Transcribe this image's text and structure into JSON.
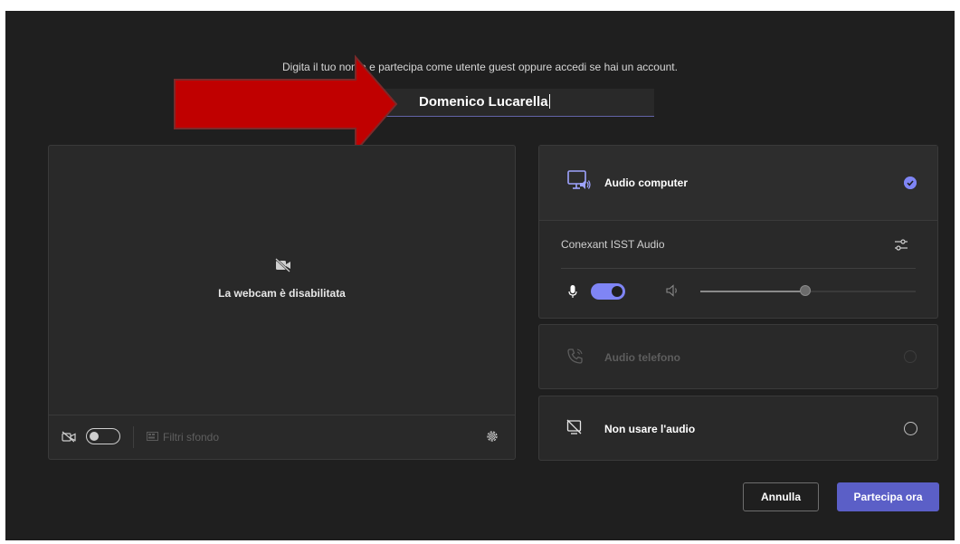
{
  "join": {
    "prompt": "Digita il tuo nome e partecipa come utente guest oppure accedi se hai un account.",
    "name_value": "Domenico Lucarella"
  },
  "video": {
    "camera_off_text": "La webcam è disabilitata",
    "background_filters_label": "Filtri sfondo",
    "camera_toggle_on": false
  },
  "audio": {
    "computer_title": "Audio computer",
    "computer_selected": true,
    "device_name": "Conexant ISST Audio",
    "mic_on": true,
    "speaker_volume_fraction": 0.5,
    "phone_title": "Audio telefono",
    "no_audio_title": "Non usare l'audio"
  },
  "actions": {
    "cancel_label": "Annulla",
    "join_label": "Partecipa ora"
  },
  "colors": {
    "accent": "#7f85f5",
    "primary_button": "#5b5fc7",
    "arrow_fill": "#c00000",
    "background": "#1f1f1f"
  }
}
